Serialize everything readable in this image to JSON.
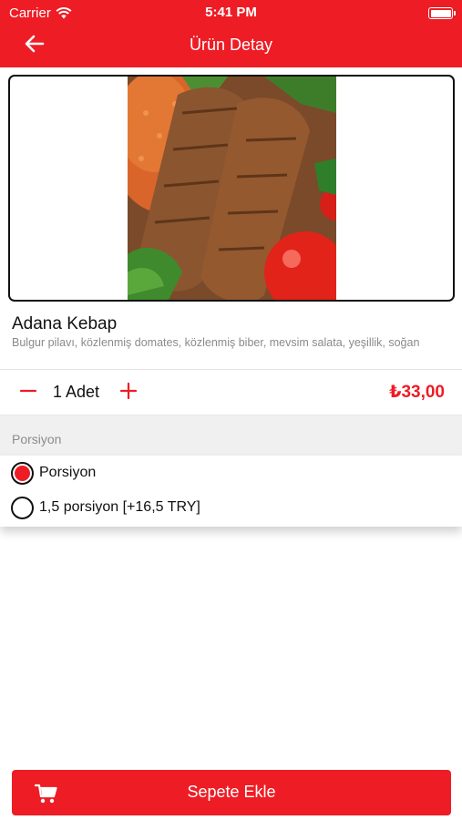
{
  "status_bar": {
    "carrier": "Carrier",
    "time": "5:41 PM"
  },
  "nav": {
    "title": "Ürün Detay",
    "back_icon": "arrow-left-icon"
  },
  "product": {
    "name": "Adana Kebap",
    "description": "Bulgur pilavı, közlenmiş domates, közlenmiş biber, mevsim salata, yeşillik, soğan",
    "quantity_label": "1 Adet",
    "price": "₺33,00"
  },
  "portion": {
    "section_label": "Porsiyon",
    "options": [
      {
        "label": "Porsiyon",
        "selected": true
      },
      {
        "label": "1,5 porsiyon [+16,5 TRY]",
        "selected": false
      }
    ]
  },
  "footer": {
    "add_to_cart_label": "Sepete Ekle",
    "cart_icon": "cart-icon"
  },
  "colors": {
    "brand": "#ee1c25",
    "section_bg": "#f0f0f0"
  }
}
